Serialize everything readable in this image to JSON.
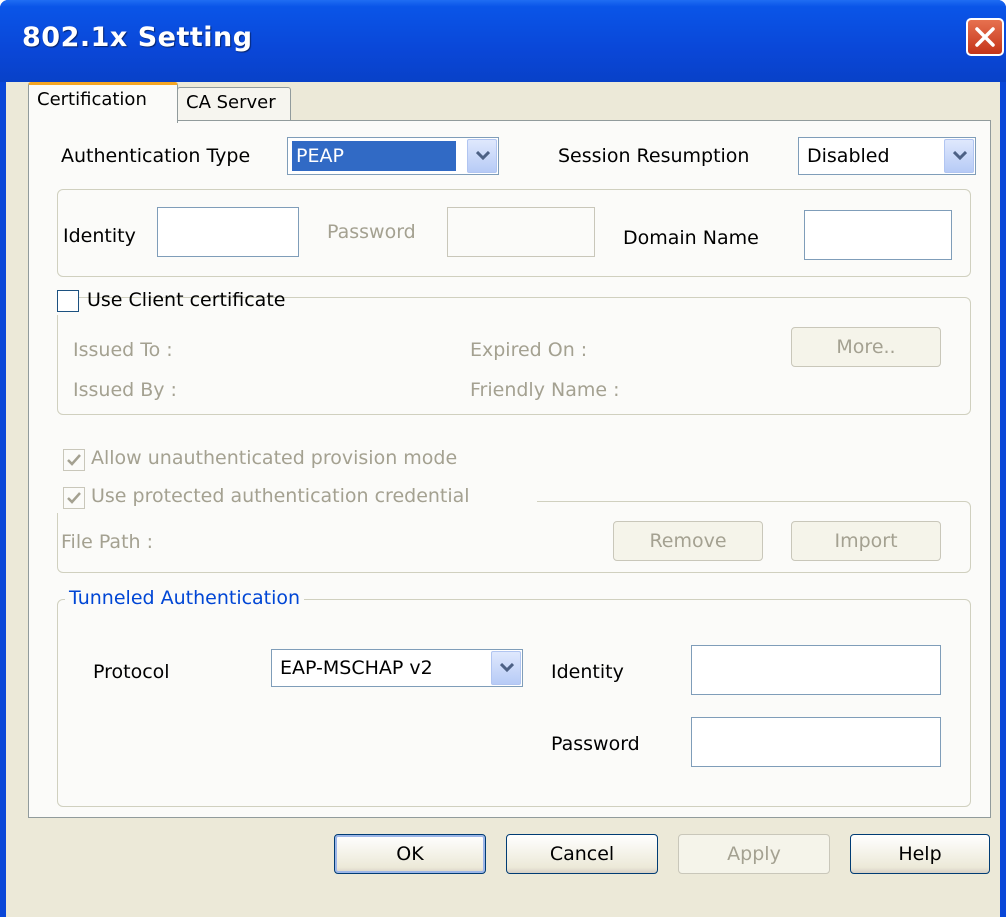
{
  "window": {
    "title": "802.1x Setting"
  },
  "tabs": [
    {
      "label": "Certification"
    },
    {
      "label": "CA Server"
    }
  ],
  "auth": {
    "type_label": "Authentication Type",
    "type_value": "PEAP",
    "session_label": "Session Resumption",
    "session_value": "Disabled"
  },
  "credentials": {
    "identity_label": "Identity",
    "identity_value": "",
    "password_label": "Password",
    "password_value": "",
    "domain_label": "Domain Name",
    "domain_value": ""
  },
  "client_cert": {
    "label": "Use Client certificate",
    "checked": false,
    "issued_to_label": "Issued To :",
    "issued_by_label": "Issued By :",
    "expired_on_label": "Expired On :",
    "friendly_name_label": "Friendly Name :",
    "more_label": "More.."
  },
  "provision": {
    "allow_label": "Allow unauthenticated provision mode",
    "allow_checked": true,
    "pac_label": "Use protected authentication credential",
    "pac_checked": true,
    "file_path_label": "File Path :",
    "remove_label": "Remove",
    "import_label": "Import"
  },
  "tunneled": {
    "title": "Tunneled Authentication",
    "protocol_label": "Protocol",
    "protocol_value": "EAP-MSCHAP v2",
    "identity_label": "Identity",
    "identity_value": "",
    "password_label": "Password",
    "password_value": ""
  },
  "buttons": {
    "ok": "OK",
    "cancel": "Cancel",
    "apply": "Apply",
    "help": "Help"
  },
  "colors": {
    "titlebar": "#0a47d8",
    "dialog_bg": "#ece9d8",
    "group_title": "#0046d5",
    "tab_highlight": "#f5a623"
  }
}
